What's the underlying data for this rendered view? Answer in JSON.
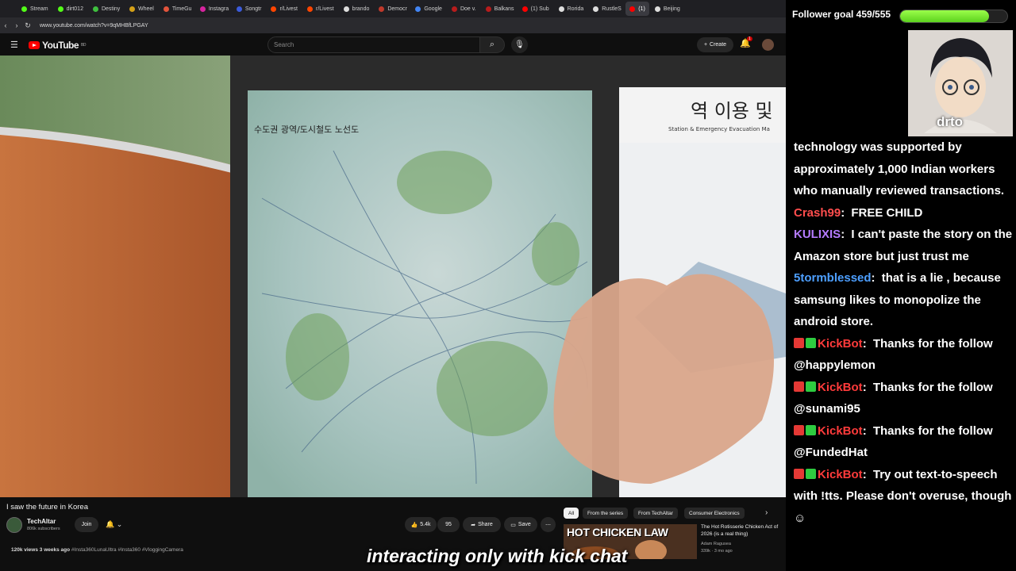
{
  "browser": {
    "tabs": [
      {
        "label": "Stream",
        "color": "#53fc18",
        "active": false
      },
      {
        "label": "dirt012",
        "color": "#53fc18",
        "active": false
      },
      {
        "label": "Destiny",
        "color": "#3fbf3f",
        "active": false
      },
      {
        "label": "Wheel",
        "color": "#d4a017",
        "active": false
      },
      {
        "label": "TimeGu",
        "color": "#e2543c",
        "active": false
      },
      {
        "label": "Instagra",
        "color": "#d6249f",
        "active": false
      },
      {
        "label": "Songtr",
        "color": "#3b5bdb",
        "active": false
      },
      {
        "label": "r/Livest",
        "color": "#ff4500",
        "active": false
      },
      {
        "label": "r/Livest",
        "color": "#ff4500",
        "active": false
      },
      {
        "label": "brando",
        "color": "#dddddd",
        "active": false
      },
      {
        "label": "Democr",
        "color": "#c0392b",
        "active": false
      },
      {
        "label": "Google",
        "color": "#4285f4",
        "active": false
      },
      {
        "label": "Doe v.",
        "color": "#b71c1c",
        "active": false
      },
      {
        "label": "Balkans",
        "color": "#b71c1c",
        "active": false
      },
      {
        "label": "(1) Sub",
        "color": "#ff0000",
        "active": false
      },
      {
        "label": "Rorida",
        "color": "#dddddd",
        "active": false
      },
      {
        "label": "RustleS",
        "color": "#dddddd",
        "active": false
      },
      {
        "label": "(1)",
        "color": "#ff0000",
        "active": true
      },
      {
        "label": "Beijing",
        "color": "#dddddd",
        "active": false
      }
    ],
    "url": "www.youtube.com/watch?v=9qMHBfLPGAY"
  },
  "youtube": {
    "logo_text": "YouTube",
    "logo_sup": "BD",
    "search_placeholder": "Search",
    "create_label": "Create",
    "notif_count": "1"
  },
  "video": {
    "title": "I saw the future in Korea",
    "channel": "TechAltar",
    "subscribers": "806k subscribers",
    "join_label": "Join",
    "likes": "5.4k",
    "comments": "95",
    "share_label": "Share",
    "save_label": "Save",
    "views": "120k views",
    "age": "3 weeks ago",
    "tags": "#Insta360LunaUltra #Insta360 #VloggingCamera",
    "map_sign_text": "역 이용 및",
    "map_sign_sub": "Station & Emergency Evacuation Ma",
    "map_title": "수도권 광역/도시철도 노선도"
  },
  "recommendations": {
    "chips": [
      "All",
      "From the series",
      "From TechAltar",
      "Consumer Electronics"
    ],
    "item": {
      "thumb_text": "HOT CHICKEN LAW",
      "title": "The Hot Rotisserie Chicken Act of 2026 (is a real thing)",
      "channel": "Adam Ragusea",
      "meta": "339k · 3 mo ago"
    }
  },
  "caption": "interacting only with kick chat",
  "overlay": {
    "goal_label": "Follower goal 459/555",
    "goal_current": 459,
    "goal_total": 555,
    "goal_color": "#7ee22e",
    "cam_name": "drto",
    "chat": [
      {
        "user": "",
        "user_color": "#ffffff",
        "badges": [],
        "text": "technology was supported by approximately 1,000 Indian workers who manually reviewed transactions."
      },
      {
        "user": "Crash99",
        "user_color": "#ff4d4d",
        "badges": [],
        "text": "FREE CHILD"
      },
      {
        "user": "KULIXIS",
        "user_color": "#b57cff",
        "badges": [],
        "text": "I can't paste the story on the Amazon store but just trust me"
      },
      {
        "user": "5tormblessed",
        "user_color": "#4d9fff",
        "badges": [],
        "text": "that is a lie , because samsung likes to monopolize the android store."
      },
      {
        "user": "KickBot",
        "user_color": "#ff3b3b",
        "badges": [
          "#e53935",
          "#2ecc40"
        ],
        "text": "Thanks for the follow @happylemon"
      },
      {
        "user": "KickBot",
        "user_color": "#ff3b3b",
        "badges": [
          "#e53935",
          "#2ecc40"
        ],
        "text": "Thanks for the follow @sunami95"
      },
      {
        "user": "KickBot",
        "user_color": "#ff3b3b",
        "badges": [
          "#e53935",
          "#2ecc40"
        ],
        "text": "Thanks for the follow @FundedHat"
      },
      {
        "user": "KickBot",
        "user_color": "#ff3b3b",
        "badges": [
          "#e53935",
          "#2ecc40"
        ],
        "text": "Try out text-to-speech with !tts. Please don't overuse, though ☺"
      }
    ]
  }
}
